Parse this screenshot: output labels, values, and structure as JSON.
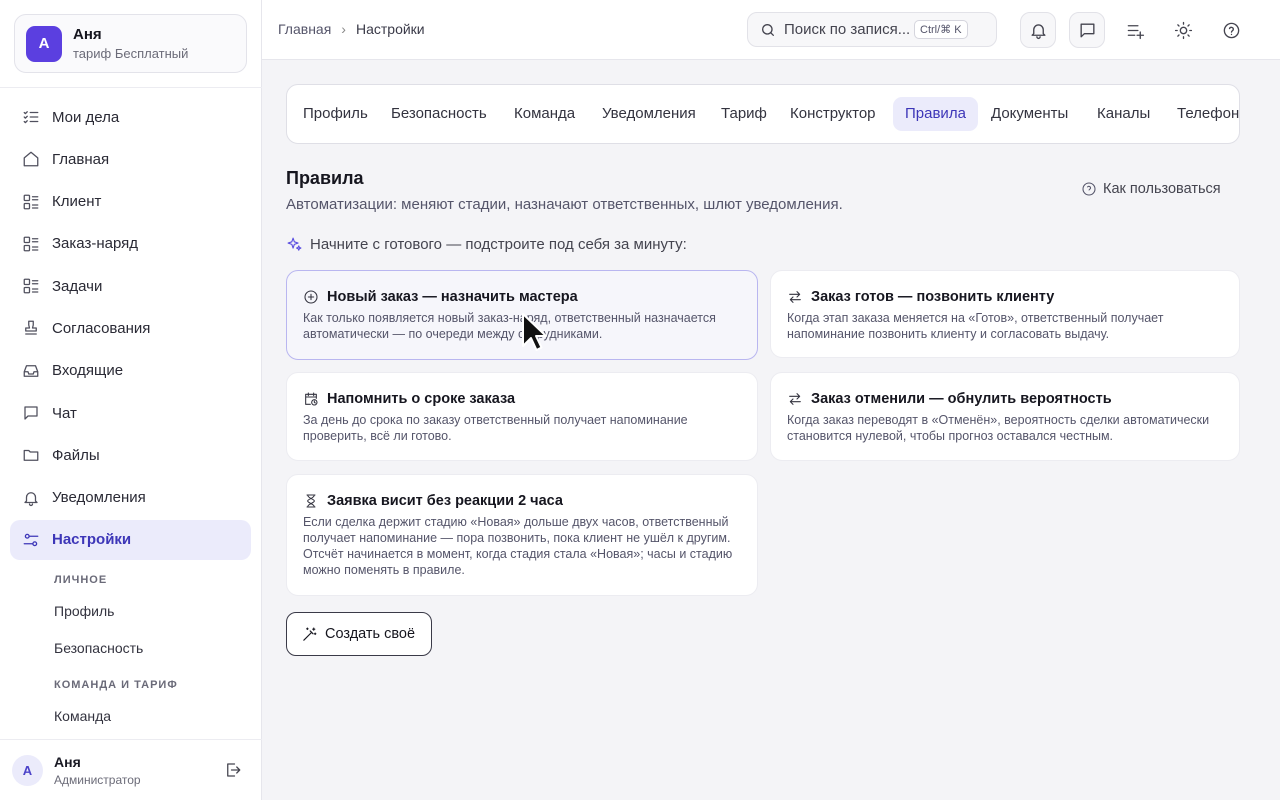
{
  "account": {
    "avatar": "А",
    "name": "Аня",
    "plan": "тариф Бесплатный"
  },
  "nav": [
    {
      "label": "Мои дела",
      "icon": "tasks-list-icon"
    },
    {
      "label": "Главная",
      "icon": "home-icon"
    },
    {
      "label": "Клиент",
      "icon": "list-grid-icon"
    },
    {
      "label": "Заказ-наряд",
      "icon": "list-grid-icon"
    },
    {
      "label": "Задачи",
      "icon": "list-grid-icon"
    },
    {
      "label": "Согласования",
      "icon": "stamp-icon"
    },
    {
      "label": "Входящие",
      "icon": "inbox-icon"
    },
    {
      "label": "Чат",
      "icon": "chat-icon"
    },
    {
      "label": "Файлы",
      "icon": "folder-icon"
    },
    {
      "label": "Уведомления",
      "icon": "bell-icon"
    },
    {
      "label": "Настройки",
      "icon": "sliders-icon",
      "active": true
    }
  ],
  "settings_sub": {
    "personal_heading": "ЛИЧНОЕ",
    "profile": "Профиль",
    "security": "Безопасность",
    "team_heading": "КОМАНДА И ТАРИФ",
    "team": "Команда"
  },
  "footer": {
    "avatar": "А",
    "name": "Аня",
    "role": "Администратор"
  },
  "breadcrumb": {
    "home": "Главная",
    "current": "Настройки"
  },
  "search": {
    "placeholder": "Поиск по запися...",
    "shortcut": "Ctrl/⌘ K"
  },
  "tabs": [
    "Профиль",
    "Безопасность",
    "Команда",
    "Уведомления",
    "Тариф",
    "Конструктор",
    "Правила",
    "Документы",
    "Каналы",
    "Телефония"
  ],
  "active_tab": "Правила",
  "page": {
    "title": "Правила",
    "description": "Автоматизации: меняют стадии, назначают ответственных, шлют уведомления.",
    "help_link": "Как пользоваться",
    "hint": "Начните с готового — подстроите под себя за минуту:"
  },
  "templates": [
    {
      "title": "Новый заказ — назначить мастера",
      "icon": "plus-circle-icon",
      "text": "Как только появляется новый заказ-наряд, ответственный назначается автоматически — по очереди между сотрудниками."
    },
    {
      "title": "Заказ готов — позвонить клиенту",
      "icon": "swap-arrows-icon",
      "text": "Когда этап заказа меняется на «Готов», ответственный получает напоминание позвонить клиенту и согласовать выдачу."
    },
    {
      "title": "Напомнить о сроке заказа",
      "icon": "calendar-clock-icon",
      "text": "За день до срока по заказу ответственный получает напоминание проверить, всё ли готово."
    },
    {
      "title": "Заказ отменили — обнулить вероятность",
      "icon": "swap-arrows-icon",
      "text": "Когда заказ переводят в «Отменён», вероятность сделки автоматически становится нулевой, чтобы прогноз оставался честным."
    },
    {
      "title": "Заявка висит без реакции 2 часа",
      "icon": "hourglass-icon",
      "text": "Если сделка держит стадию «Новая» дольше двух часов, ответственный получает напоминание — пора позвонить, пока клиент не ушёл к другим. Отсчёт начинается в момент, когда стадия стала «Новая»; часы и стадию можно поменять в правиле."
    }
  ],
  "create_button": "Создать своё"
}
